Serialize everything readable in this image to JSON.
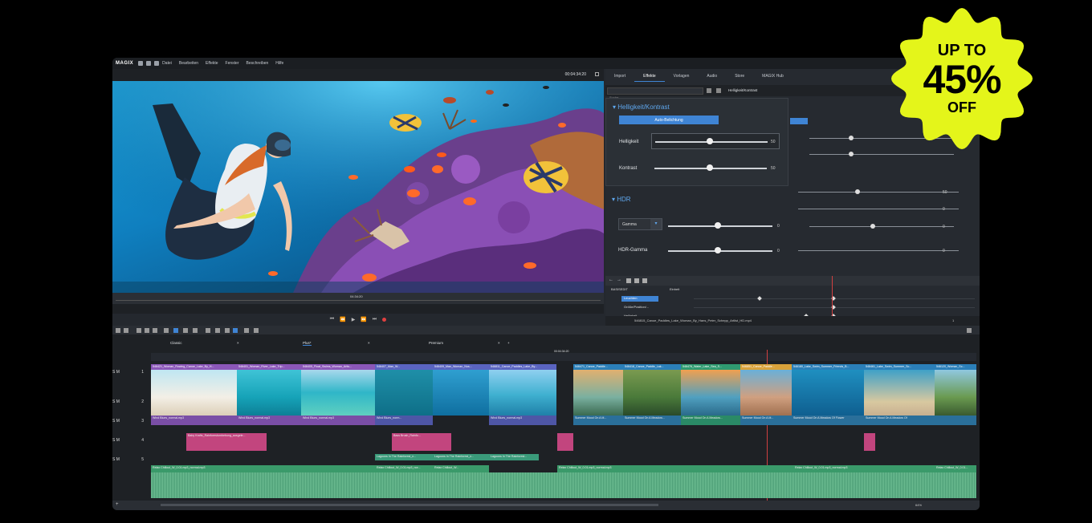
{
  "menubar": {
    "logo": "MAGIX",
    "items": [
      "Datei",
      "Bearbeiten",
      "Effekte",
      "Fenster",
      "Beschreiben",
      "Hilfe"
    ],
    "right_button": "Beschreiben"
  },
  "preview": {
    "timecode": "00:04:34:20",
    "scrub_marker": "04:34:20"
  },
  "effects": {
    "tabs": [
      "Import",
      "Effekte",
      "Vorlagen",
      "Audio",
      "Store",
      "MAGIX Hub"
    ],
    "active_tab": "Effekte",
    "search_placeholder": "Suche",
    "panel_title": "Helligkeit/Kontrast",
    "section1": "Helligkeit/Kontrast",
    "auto_button": "Auto-Belichtung",
    "helligkeit_label": "Helligkeit",
    "helligkeit_value": "50",
    "kontrast_label": "Kontrast",
    "kontrast_value": "50",
    "section2": "HDR",
    "gamma_label": "Gamma",
    "gamma_value": "0",
    "hdr_gamma_label": "HDR-Gamma",
    "hdr_gamma_value": "0",
    "bg_values": [
      "50",
      "0",
      "0",
      "0"
    ]
  },
  "keyframes": {
    "header": "BASISEDIT",
    "column": "Einheit",
    "rows": [
      "Leuchten",
      "Größe/Position/...",
      "Helligkeit"
    ],
    "file": "546815_Canoe_Paddles_Lake_Woman_By_Hans_Peter_Schepp_Artlist_HD.mp4",
    "count": "1"
  },
  "timeline": {
    "timecode": "00:04:34:20",
    "tabs": [
      {
        "label": "Classic",
        "close": "×"
      },
      {
        "label": "Plus*",
        "close": "×"
      },
      {
        "label": "Premium",
        "close": "×"
      }
    ],
    "tracks": [
      {
        "num": "1",
        "ctrl": "S M"
      },
      {
        "num": "2",
        "ctrl": "S M"
      },
      {
        "num": "3",
        "ctrl": "S M"
      },
      {
        "num": "4",
        "ctrl": "S M"
      },
      {
        "num": "5",
        "ctrl": "S M"
      }
    ],
    "video_clips": [
      {
        "title": "546421_Woman_Rowing_Canoe_Lake_By_H..."
      },
      {
        "title": "546401_Woman_River_Lake_Trip..."
      },
      {
        "title": "546405_Float_Swims_Woman_Artis..."
      },
      {
        "title": "546407_Man_W..."
      },
      {
        "title": "546409_Man_Woman_Nus..."
      },
      {
        "title": "546811_Canoe_Paddles_Lake_By..."
      },
      {
        "title": "546471_Canoe_Paddle..."
      },
      {
        "title": "546418_Canoe_Paddle_Lak..."
      },
      {
        "title": "546476_Water_Lake_Sea_S..."
      },
      {
        "title": "546851_Canoe_Paddle..."
      },
      {
        "title": "546180_Lake_Swim_Summer_Friends_B..."
      },
      {
        "title": "546461_Lake_Swim_Summer_Sc..."
      },
      {
        "title": "546120_Woman_Sc..."
      }
    ],
    "audio_row2": [
      "Wind Blues_normal.mp3",
      "Wind Blues_normal.mp3",
      "Wind Blues_normal.mp3",
      "Wind Blues_norm...",
      "Wind Blues_normal.mp3",
      "Summer Mood On A M...",
      "Summer Mood On A Meadow...",
      "Summer Mood On A Meadow...",
      "Summer Mood On A M...",
      "Summer Mood On A Meadow Of Flower",
      "Summer Mood On A Meadow Of"
    ],
    "pink_clips": [
      "Baby Krafts_Rainforestumbebung_ausgele...",
      "Bass Brush_Rainfo..."
    ],
    "row4": [
      "Lagoons In The Rainforest_n...",
      "Lagoons In The Rainforest_n...",
      "Lagoons In The Rainforest..."
    ],
    "music": [
      "Relax Chillout_W_0.01.mp3_normal.mp3",
      "Relax Chillout_W_0.01.mp3_nor...",
      "Relax Chillout_W...",
      "Relax Chillout_W_0.01.mp3_normal.mp3",
      "Relax Chillout_W_0.01.mp3_normal.mp3",
      "Relax Chillout_W_0.01..."
    ],
    "zoom": "64%"
  },
  "badge": {
    "line1": "UP TO",
    "line2": "45%",
    "line3": "OFF",
    "color": "#e4f51a"
  }
}
